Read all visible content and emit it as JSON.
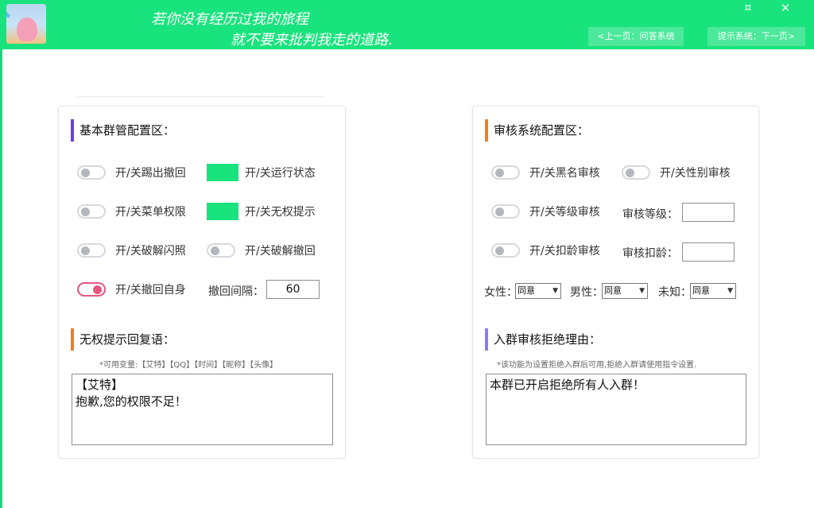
{
  "header": {
    "slogan_line1": "若你没有经历过我的旅程",
    "slogan_line2": "就不要来批判我走的道路.",
    "prev_button": "<上一页：问答系统",
    "next_button": "提示系统：下一页>",
    "restore_icon": "¤",
    "close_icon": "✕",
    "avatar": "patrick-rainbow-avatar"
  },
  "colors": {
    "header_green": "#19e37d",
    "toggle_on_pink": "#e8567f",
    "left_bar_purple": "#6a3ee8",
    "bar_orange": "#f07d1a",
    "bar_violet": "#8a7cf5"
  },
  "left_panel": {
    "title": "基本群管配置区：",
    "toggles": [
      {
        "label": "开/关踢出撤回",
        "state": "off"
      },
      {
        "label": "开/关运行状态",
        "state": "green"
      },
      {
        "label": "开/关菜单权限",
        "state": "off"
      },
      {
        "label": "开/关无权提示",
        "state": "green"
      },
      {
        "label": "开/关破解闪照",
        "state": "off"
      },
      {
        "label": "开/关破解撤回",
        "state": "off"
      },
      {
        "label": "开/关撤回自身",
        "state": "on"
      }
    ],
    "recall_interval_label": "撤回间隔：",
    "recall_interval_value": "60",
    "reply_title": "无权提示回复语：",
    "variables_hint": "*可用变量:【艾特】【QQ】【时间】【昵称】【头像】",
    "reply_text": "【艾特】\n抱歉,您的权限不足！"
  },
  "right_panel": {
    "title": "审核系统配置区：",
    "toggles": [
      {
        "label": "开/关黑名审核",
        "state": "off"
      },
      {
        "label": "开/关性别审核",
        "state": "off"
      },
      {
        "label": "开/关等级审核",
        "state": "off"
      },
      {
        "label": "开/关扣龄审核",
        "state": "off"
      }
    ],
    "level_label": "审核等级：",
    "level_value": "",
    "age_label": "审核扣龄：",
    "age_value": "",
    "gender_female_label": "女性：",
    "gender_female_value": "同意",
    "gender_male_label": "男性：",
    "gender_male_value": "同意",
    "gender_unknown_label": "未知：",
    "gender_unknown_value": "同意",
    "reject_title": "入群审核拒绝理由：",
    "reject_hint": "*该功能为设置拒绝入群后可用,拒绝入群请使用指令设置.",
    "reject_text": "本群已开启拒绝所有人入群！"
  }
}
